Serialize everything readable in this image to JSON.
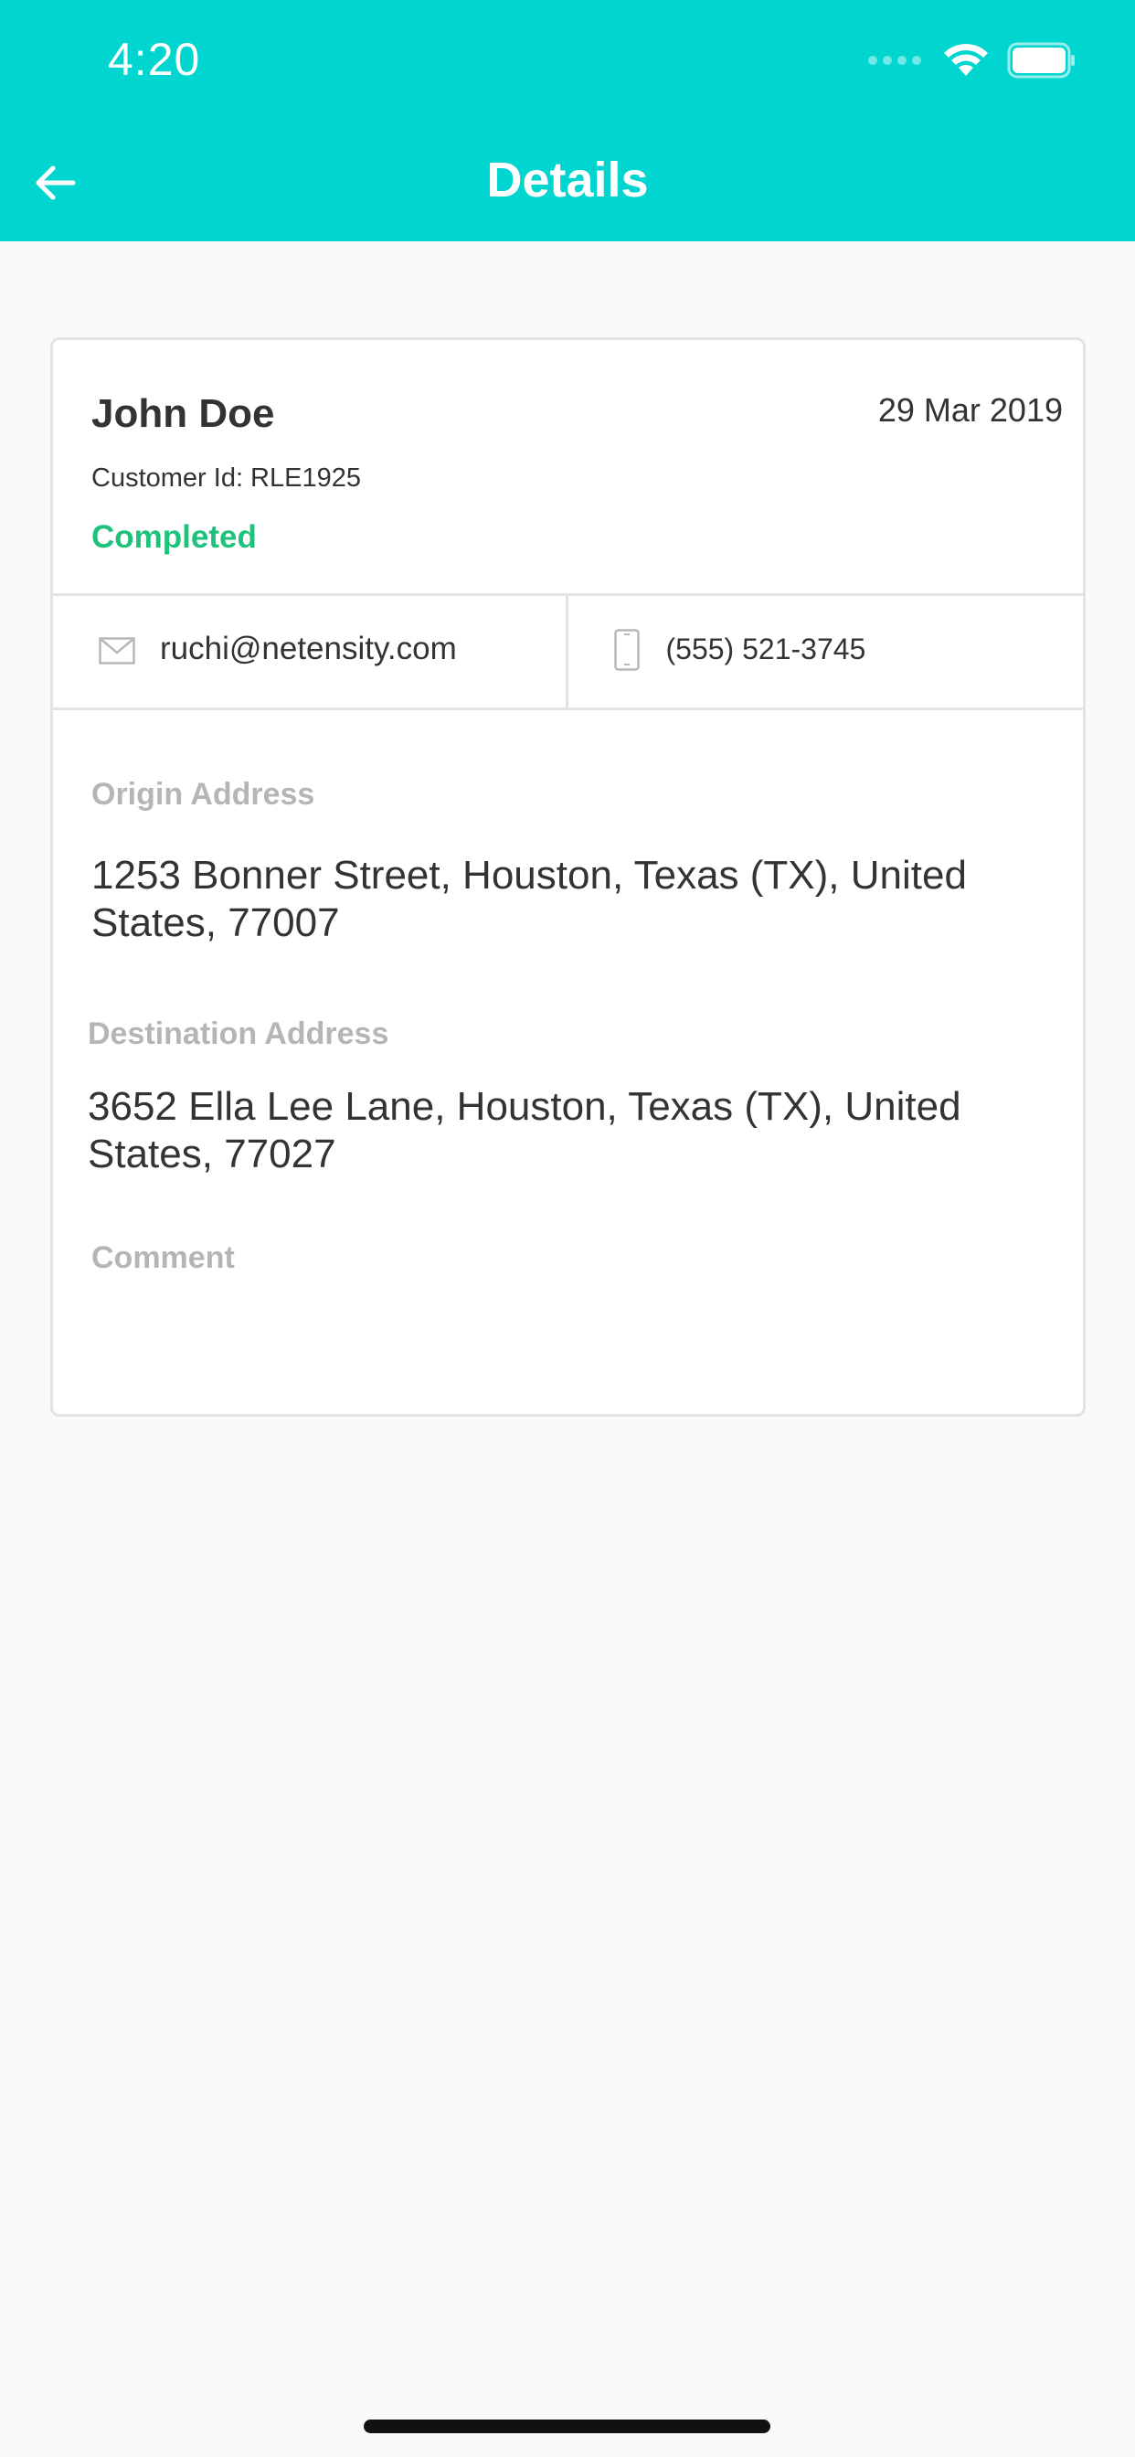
{
  "status_bar": {
    "time": "4:20"
  },
  "header": {
    "title": "Details",
    "back_icon": "arrow-left-icon"
  },
  "customer": {
    "name": "John Doe",
    "date": "29 Mar 2019",
    "customer_id": "Customer Id: RLE1925",
    "status": "Completed",
    "email": "ruchi@netensity.com",
    "phone": "(555) 521-3745"
  },
  "origin": {
    "label": "Origin Address",
    "address": "1253 Bonner Street, Houston, Texas (TX), United States, 77007"
  },
  "destination": {
    "label": "Destination Address",
    "address": "3652 Ella Lee Lane, Houston, Texas (TX), United States, 77027"
  },
  "comment": {
    "label": "Comment"
  },
  "colors": {
    "header": "#00d5cf",
    "status_completed": "#1ec27a",
    "label_gray": "#b5b5b5",
    "text_dark": "#333333"
  }
}
